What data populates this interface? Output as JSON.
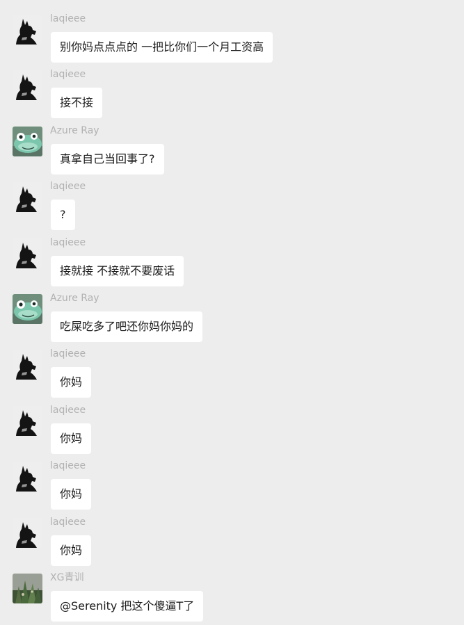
{
  "messages": [
    {
      "sender": "laqieee",
      "avatar": "black-dog-avatar",
      "text": "别你妈点点点的 一把比你们一个月工资高"
    },
    {
      "sender": "laqieee",
      "avatar": "black-dog-avatar",
      "text": "接不接"
    },
    {
      "sender": "Azure Ray",
      "avatar": "green-frog-avatar",
      "text": "真拿自己当回事了?"
    },
    {
      "sender": "laqieee",
      "avatar": "black-dog-avatar",
      "text": "?"
    },
    {
      "sender": "laqieee",
      "avatar": "black-dog-avatar",
      "text": "接就接 不接就不要废话"
    },
    {
      "sender": "Azure Ray",
      "avatar": "green-frog-avatar",
      "text": "吃屎吃多了吧还你妈你妈的"
    },
    {
      "sender": "laqieee",
      "avatar": "black-dog-avatar",
      "text": "你妈"
    },
    {
      "sender": "laqieee",
      "avatar": "black-dog-avatar",
      "text": "你妈"
    },
    {
      "sender": "laqieee",
      "avatar": "black-dog-avatar",
      "text": "你妈"
    },
    {
      "sender": "laqieee",
      "avatar": "black-dog-avatar",
      "text": "你妈"
    },
    {
      "sender": "XG青训",
      "avatar": "plant-photo-avatar",
      "text": "@Serenity 把这个傻逼T了"
    }
  ],
  "colors": {
    "background": "#ededed",
    "bubble": "#ffffff",
    "sender_name": "#b1b1b1",
    "text": "#1b1b1b"
  }
}
